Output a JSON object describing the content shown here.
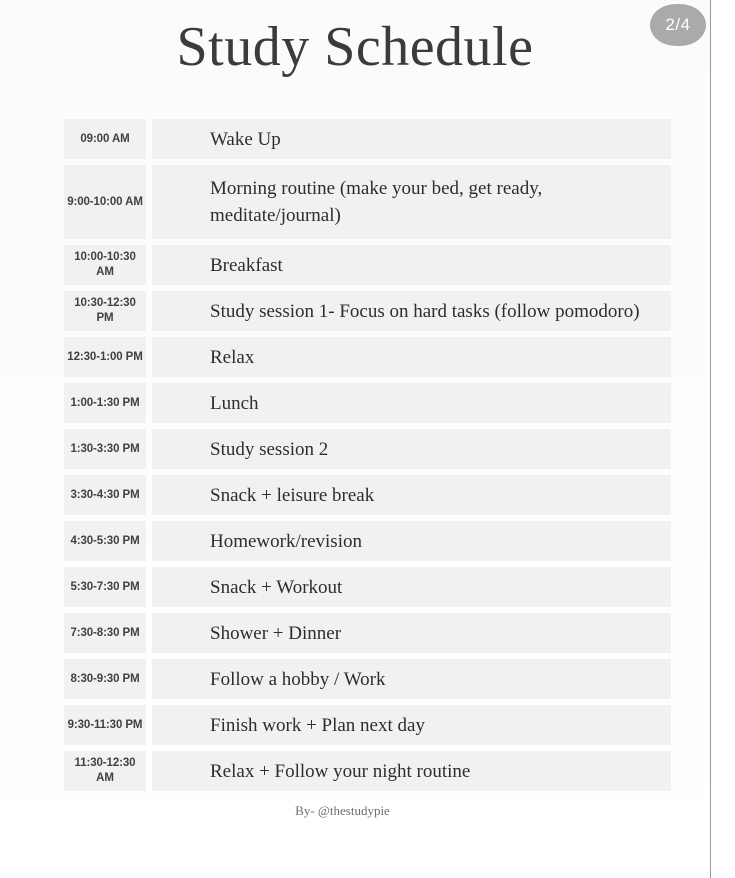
{
  "page": {
    "badge": "2/4",
    "title": "Study Schedule",
    "credit": "By- @thestudypie",
    "colors": {
      "cell_background": "#f1f1f1",
      "page_background": "#ffffff",
      "badge_background": "#aaaaaa",
      "title_text": "#3b3b3d",
      "task_text": "#2d2d2f",
      "time_text": "#414143",
      "credit_text": "#6e6e70"
    }
  },
  "schedule": {
    "rows": [
      {
        "time": "09:00 AM",
        "task": "Wake Up",
        "lines": 1
      },
      {
        "time": "9:00-10:00 AM",
        "task": "Morning routine (make your bed, get ready, meditate/journal)",
        "lines": 2
      },
      {
        "time": "10:00-10:30 AM",
        "task": "Breakfast",
        "lines": 1
      },
      {
        "time": "10:30-12:30 PM",
        "task": "Study session 1- Focus on hard tasks (follow pomodoro)",
        "lines": 1
      },
      {
        "time": "12:30-1:00 PM",
        "task": "Relax",
        "lines": 1
      },
      {
        "time": "1:00-1:30 PM",
        "task": "Lunch",
        "lines": 1
      },
      {
        "time": "1:30-3:30 PM",
        "task": "Study session 2",
        "lines": 1
      },
      {
        "time": "3:30-4:30 PM",
        "task": "Snack + leisure break",
        "lines": 1
      },
      {
        "time": "4:30-5:30 PM",
        "task": "Homework/revision",
        "lines": 1
      },
      {
        "time": "5:30-7:30 PM",
        "task": "Snack + Workout",
        "lines": 1
      },
      {
        "time": "7:30-8:30 PM",
        "task": "Shower + Dinner",
        "lines": 1
      },
      {
        "time": "8:30-9:30 PM",
        "task": "Follow a hobby / Work",
        "lines": 1
      },
      {
        "time": "9:30-11:30 PM",
        "task": "Finish work + Plan next day",
        "lines": 1
      },
      {
        "time": "11:30-12:30 AM",
        "task": "Relax + Follow your night routine",
        "lines": 1
      }
    ]
  }
}
